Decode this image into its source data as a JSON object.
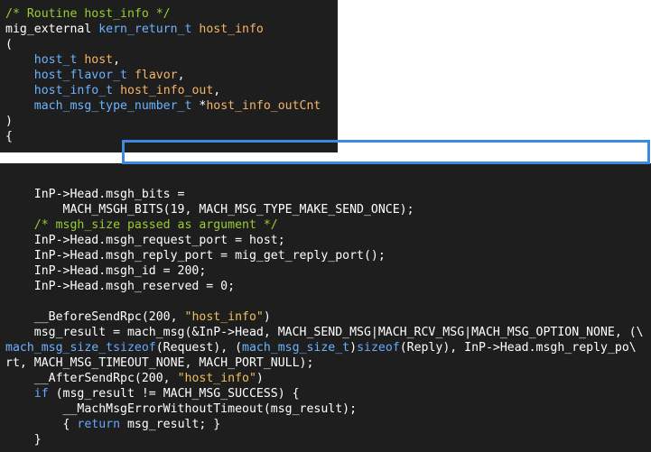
{
  "panel1": {
    "lines": [
      [
        {
          "cls": "c-comment",
          "t": "/* Routine host_info */"
        }
      ],
      [
        {
          "cls": "c-plain",
          "t": "mig_external "
        },
        {
          "cls": "c-type",
          "t": "kern_return_t"
        },
        {
          "cls": "c-plain",
          "t": " "
        },
        {
          "cls": "c-name",
          "t": "host_info"
        }
      ],
      [
        {
          "cls": "c-plain",
          "t": "("
        }
      ],
      [
        {
          "cls": "c-plain",
          "t": "    "
        },
        {
          "cls": "c-type",
          "t": "host_t"
        },
        {
          "cls": "c-plain",
          "t": " "
        },
        {
          "cls": "c-name",
          "t": "host"
        },
        {
          "cls": "c-plain",
          "t": ","
        }
      ],
      [
        {
          "cls": "c-plain",
          "t": "    "
        },
        {
          "cls": "c-type",
          "t": "host_flavor_t"
        },
        {
          "cls": "c-plain",
          "t": " "
        },
        {
          "cls": "c-name",
          "t": "flavor"
        },
        {
          "cls": "c-plain",
          "t": ","
        }
      ],
      [
        {
          "cls": "c-plain",
          "t": "    "
        },
        {
          "cls": "c-type",
          "t": "host_info_t"
        },
        {
          "cls": "c-plain",
          "t": " "
        },
        {
          "cls": "c-name",
          "t": "host_info_out"
        },
        {
          "cls": "c-plain",
          "t": ","
        }
      ],
      [
        {
          "cls": "c-plain",
          "t": "    "
        },
        {
          "cls": "c-type",
          "t": "mach_msg_type_number_t"
        },
        {
          "cls": "c-plain",
          "t": " *"
        },
        {
          "cls": "c-name",
          "t": "host_info_outCnt"
        }
      ],
      [
        {
          "cls": "c-plain",
          "t": ")"
        }
      ],
      [
        {
          "cls": "c-plain",
          "t": "{"
        }
      ]
    ]
  },
  "panel2": {
    "lines": [
      [
        {
          "cls": "c-plain",
          "t": ""
        }
      ],
      [
        {
          "cls": "c-plain",
          "t": "    InP->Head.msgh_bits ="
        }
      ],
      [
        {
          "cls": "c-plain",
          "t": "        MACH_MSGH_BITS(19, MACH_MSG_TYPE_MAKE_SEND_ONCE);"
        }
      ],
      [
        {
          "cls": "c-comment",
          "t": "    /* msgh_size passed as argument */"
        }
      ],
      [
        {
          "cls": "c-plain",
          "t": "    InP->Head.msgh_request_port = host;"
        }
      ],
      [
        {
          "cls": "c-plain",
          "t": "    InP->Head.msgh_reply_port = mig_get_reply_port();"
        }
      ],
      [
        {
          "cls": "c-plain",
          "t": "    InP->Head.msgh_id = 200;"
        }
      ],
      [
        {
          "cls": "c-plain",
          "t": "    InP->Head.msgh_reserved = 0;"
        }
      ],
      [
        {
          "cls": "c-plain",
          "t": ""
        }
      ],
      [
        {
          "cls": "c-plain",
          "t": "    __BeforeSendRpc(200, "
        },
        {
          "cls": "c-str",
          "t": "\"host_info\""
        },
        {
          "cls": "c-plain",
          "t": ")"
        }
      ],
      [
        {
          "cls": "c-plain",
          "t": "    msg_result = mach_msg(&InP->Head, MACH_SEND_MSG|MACH_RCV_MSG|MACH_MSG_OPTION_NONE, (\\"
        }
      ],
      [
        {
          "cls": "c-type",
          "t": "mach_msg_size_t"
        },
        {
          "cls": "c-kw",
          "t": "sizeof"
        },
        {
          "cls": "c-plain",
          "t": "(Request), ("
        },
        {
          "cls": "c-type",
          "t": "mach_msg_size_t"
        },
        {
          "cls": "c-plain",
          "t": ")"
        },
        {
          "cls": "c-kw",
          "t": "sizeof"
        },
        {
          "cls": "c-plain",
          "t": "(Reply), InP->Head.msgh_reply_po\\"
        }
      ],
      [
        {
          "cls": "c-plain",
          "t": "rt, MACH_MSG_TIMEOUT_NONE, MACH_PORT_NULL);"
        }
      ],
      [
        {
          "cls": "c-plain",
          "t": "    __AfterSendRpc(200, "
        },
        {
          "cls": "c-str",
          "t": "\"host_info\""
        },
        {
          "cls": "c-plain",
          "t": ")"
        }
      ],
      [
        {
          "cls": "c-plain",
          "t": "    "
        },
        {
          "cls": "c-kw",
          "t": "if"
        },
        {
          "cls": "c-plain",
          "t": " (msg_result != MACH_MSG_SUCCESS) {"
        }
      ],
      [
        {
          "cls": "c-plain",
          "t": "        __MachMsgErrorWithoutTimeout(msg_result);"
        }
      ],
      [
        {
          "cls": "c-plain",
          "t": "        { "
        },
        {
          "cls": "c-kw",
          "t": "return"
        },
        {
          "cls": "c-plain",
          "t": " msg_result; }"
        }
      ],
      [
        {
          "cls": "c-plain",
          "t": "    }"
        }
      ]
    ]
  },
  "colors": {
    "background": "#1e1e1e",
    "highlight": "#3a8ae0",
    "comment": "#9acd32",
    "type": "#6cb4ff",
    "name": "#f5b567"
  }
}
